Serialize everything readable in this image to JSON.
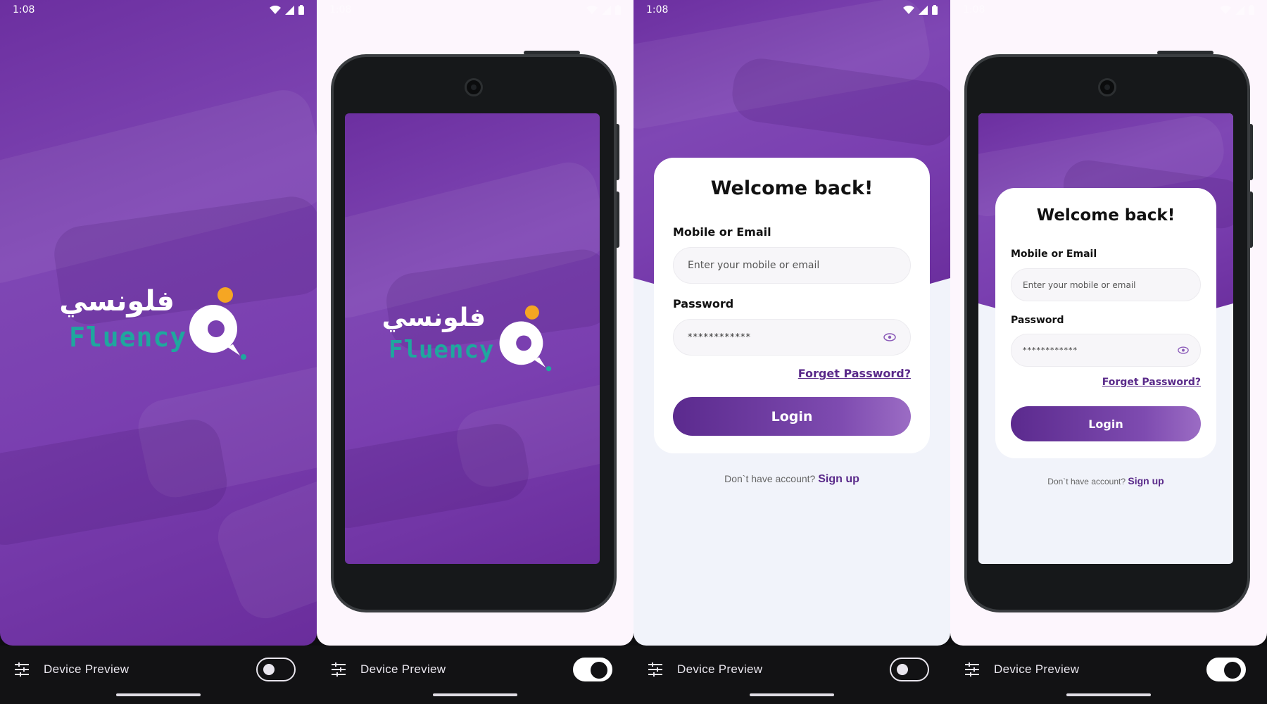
{
  "status_bar": {
    "time": "1:08"
  },
  "bottom_bar": {
    "label": "Device Preview"
  },
  "toggles": {
    "panel1": "off",
    "panel2": "on",
    "panel3": "off",
    "panel4": "on"
  },
  "logo": {
    "arabic": "فلونسي",
    "english": "Fluency"
  },
  "login": {
    "title": "Welcome back!",
    "email_label": "Mobile or Email",
    "email_placeholder": "Enter your mobile or email",
    "password_label": "Password",
    "password_value": "************",
    "forget_password": "Forget Password?",
    "login_button": "Login",
    "no_account_text": "Don`t have account?",
    "signup_link": "Sign up"
  },
  "colors": {
    "brand_purple": "#6c2fa0",
    "brand_teal": "#1fa79e",
    "logo_dot": "#f5a623",
    "link_purple": "#5a2a8a"
  },
  "icons": [
    "wifi-icon",
    "signal-icon",
    "battery-icon",
    "tune-icon",
    "eye-icon",
    "camera-icon"
  ]
}
